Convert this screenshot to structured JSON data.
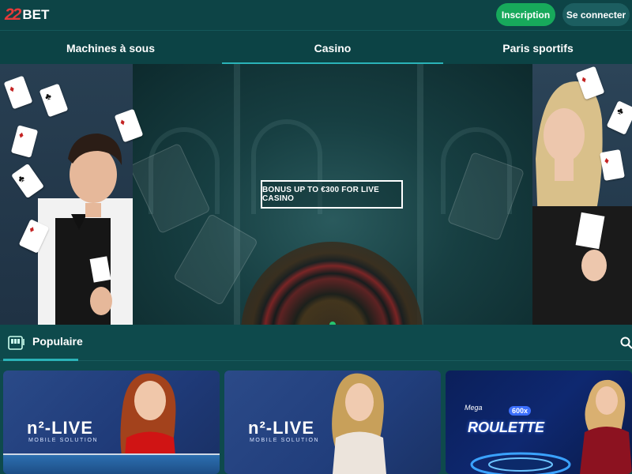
{
  "header": {
    "logo": {
      "num": "22",
      "text": "BET"
    },
    "buttons": {
      "register": "Inscription",
      "login": "Se connecter"
    },
    "colors": {
      "register_bg": "#17a95b",
      "accent": "#e43a3a"
    }
  },
  "tabs": [
    {
      "label": "Machines à sous",
      "active": false
    },
    {
      "label": "Casino",
      "active": true
    },
    {
      "label": "Paris sportifs",
      "active": false
    }
  ],
  "banner": {
    "promo_text": "BONUS UP TO €300 FOR LIVE CASINO"
  },
  "popular": {
    "icon": "slot-machine-icon",
    "label": "Populaire",
    "search_icon": "search-icon"
  },
  "games": [
    {
      "brand": "n²-LIVE",
      "sub": "MOBILE SOLUTION"
    },
    {
      "brand": "n²-LIVE",
      "sub": "MOBILE SOLUTION"
    },
    {
      "badge": "600x",
      "title_small": "Mega",
      "title": "ROULETTE"
    }
  ]
}
